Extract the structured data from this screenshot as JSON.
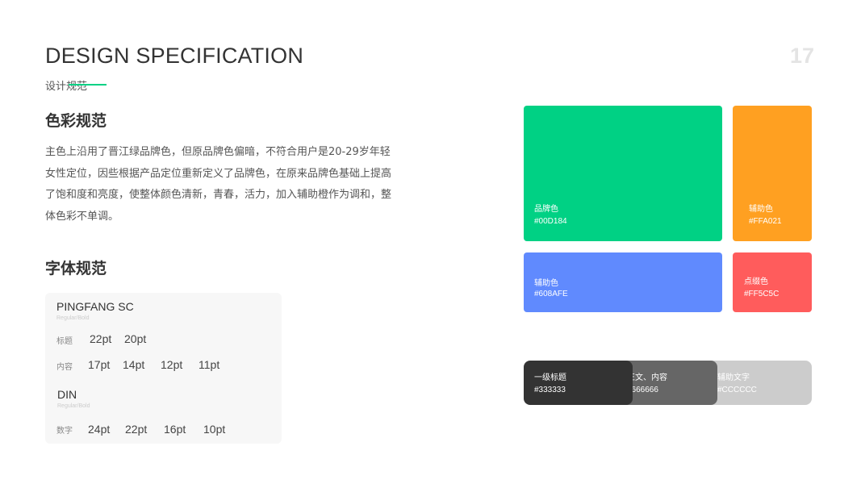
{
  "header": {
    "title": "DESIGN SPECIFICATION",
    "page_number": "17",
    "subtitle": "设计规范",
    "accent": "#00D184"
  },
  "color_section": {
    "heading": "色彩规范",
    "description_lines": [
      "主色上沿用了晋江绿品牌色，但原品牌色偏暗，不符合用户是20-29岁年轻",
      "女性定位，因些根据产品定位重新定义了品牌色，在原来品牌色基础上提高",
      "了饱和度和亮度，使整体颜色清新，青春，活力，加入辅助橙作为调和，整",
      "体色彩不单调。"
    ]
  },
  "font_section": {
    "heading": "字体规范",
    "pingfang": {
      "name": "PINGFANG SC",
      "weights": "Regular/Bold",
      "title_label": "标题",
      "title_sizes": [
        "22pt",
        "20pt"
      ],
      "content_label": "内容",
      "content_sizes": [
        "17pt",
        "14pt",
        "12pt",
        "11pt"
      ]
    },
    "din": {
      "name": "DIN",
      "weights": "Regular/Bold",
      "number_label": "数字",
      "number_sizes": [
        "24pt",
        "22pt",
        "16pt",
        "10pt"
      ]
    }
  },
  "swatches": {
    "brand": {
      "label": "品牌色",
      "hex": "#00D184"
    },
    "aux_orange": {
      "label": "辅助色",
      "hex": "#FFA021"
    },
    "aux_blue": {
      "label": "辅助色",
      "hex": "#608AFE"
    },
    "accent_red": {
      "label": "点缀色",
      "hex": "#FF5C5C"
    }
  },
  "text_colors": [
    {
      "label": "一级标题",
      "hex": "#333333"
    },
    {
      "label": "正文、内容",
      "hex": "#666666"
    },
    {
      "label": "辅助文字",
      "hex": "#CCCCCC"
    }
  ]
}
